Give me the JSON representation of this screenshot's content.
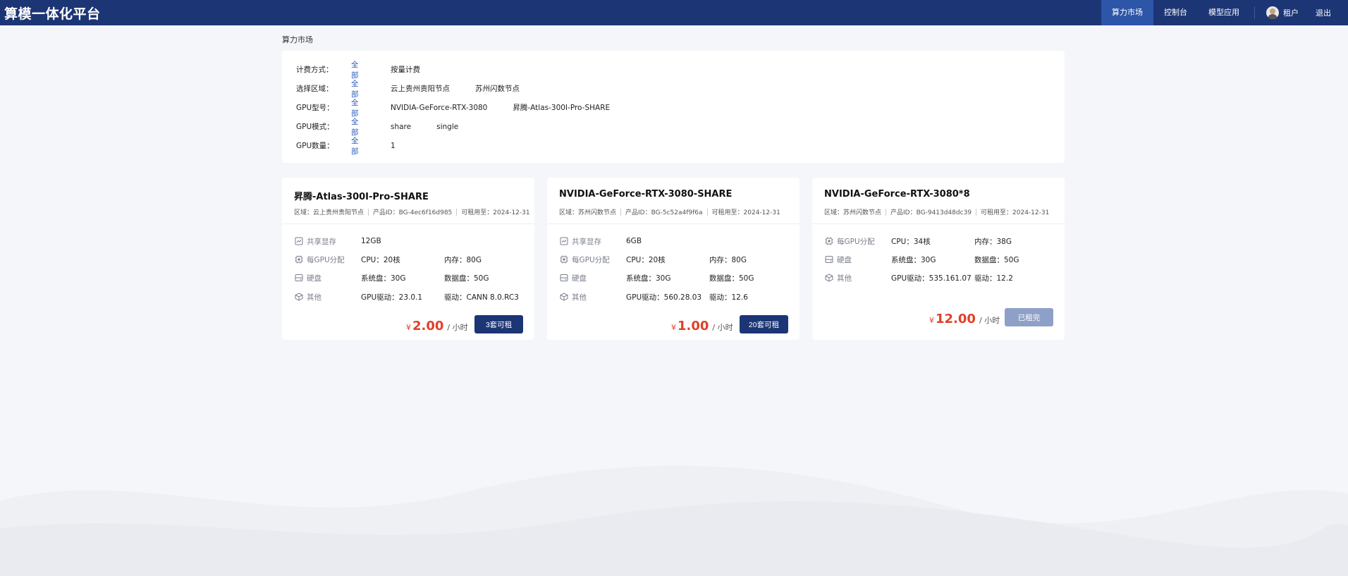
{
  "header": {
    "brand": "算模一体化平台",
    "nav": [
      {
        "label": "算力市场",
        "active": true
      },
      {
        "label": "控制台",
        "active": false
      },
      {
        "label": "模型应用",
        "active": false
      }
    ],
    "user_label": "租户",
    "logout_label": "退出"
  },
  "breadcrumb": "算力市场",
  "filters": [
    {
      "label": "计费方式：",
      "options": [
        "全部",
        "按量计费"
      ]
    },
    {
      "label": "选择区域：",
      "options": [
        "全部",
        "云上贵州贵阳节点",
        "苏州闪数节点"
      ]
    },
    {
      "label": "GPU型号：",
      "options": [
        "全部",
        "NVIDIA-GeForce-RTX-3080",
        "昇腾-Atlas-300I-Pro-SHARE"
      ]
    },
    {
      "label": "GPU模式：",
      "options": [
        "全部",
        "share",
        "single"
      ]
    },
    {
      "label": "GPU数量：",
      "options": [
        "全部",
        "1"
      ]
    }
  ],
  "cards": [
    {
      "title": "昇腾-Atlas-300I-Pro-SHARE",
      "region": "区域：云上贵州贵阳节点",
      "product_id": "产品ID：BG-4ec6f16d985",
      "expire": "可租用至：2024-12-31",
      "specs": [
        {
          "icon": "shared-memory-icon",
          "name": "共享显存",
          "v1": "12GB",
          "v2": ""
        },
        {
          "icon": "gpu-allocation-icon",
          "name": "每GPU分配",
          "v1": "CPU：20核",
          "v2": "内存：80G"
        },
        {
          "icon": "disk-icon",
          "name": "硬盘",
          "v1": "系统盘：30G",
          "v2": "数据盘：50G"
        },
        {
          "icon": "other-icon",
          "name": "其他",
          "v1": "GPU驱动：23.0.1",
          "v2": "驱动：CANN 8.0.RC3"
        }
      ],
      "currency": "¥",
      "price": "2.00",
      "unit": "/ 小时",
      "button": "3套可租",
      "available": true
    },
    {
      "title": "NVIDIA-GeForce-RTX-3080-SHARE",
      "region": "区域：苏州闪数节点",
      "product_id": "产品ID：BG-5c52a4f9f6a",
      "expire": "可租用至：2024-12-31",
      "specs": [
        {
          "icon": "shared-memory-icon",
          "name": "共享显存",
          "v1": "6GB",
          "v2": ""
        },
        {
          "icon": "gpu-allocation-icon",
          "name": "每GPU分配",
          "v1": "CPU：20核",
          "v2": "内存：80G"
        },
        {
          "icon": "disk-icon",
          "name": "硬盘",
          "v1": "系统盘：30G",
          "v2": "数据盘：50G"
        },
        {
          "icon": "other-icon",
          "name": "其他",
          "v1": "GPU驱动：560.28.03",
          "v2": "驱动：12.6"
        }
      ],
      "currency": "¥",
      "price": "1.00",
      "unit": "/ 小时",
      "button": "20套可租",
      "available": true
    },
    {
      "title": "NVIDIA-GeForce-RTX-3080*8",
      "region": "区域：苏州闪数节点",
      "product_id": "产品ID：BG-9413d48dc39",
      "expire": "可租用至：2024-12-31",
      "specs": [
        {
          "icon": "gpu-allocation-icon",
          "name": "每GPU分配",
          "v1": "CPU：34核",
          "v2": "内存：38G"
        },
        {
          "icon": "disk-icon",
          "name": "硬盘",
          "v1": "系统盘：30G",
          "v2": "数据盘：50G"
        },
        {
          "icon": "other-icon",
          "name": "其他",
          "v1": "GPU驱动：535.161.07",
          "v2": "驱动：12.2"
        }
      ],
      "currency": "¥",
      "price": "12.00",
      "unit": "/ 小时",
      "button": "已租完",
      "available": false
    }
  ]
}
